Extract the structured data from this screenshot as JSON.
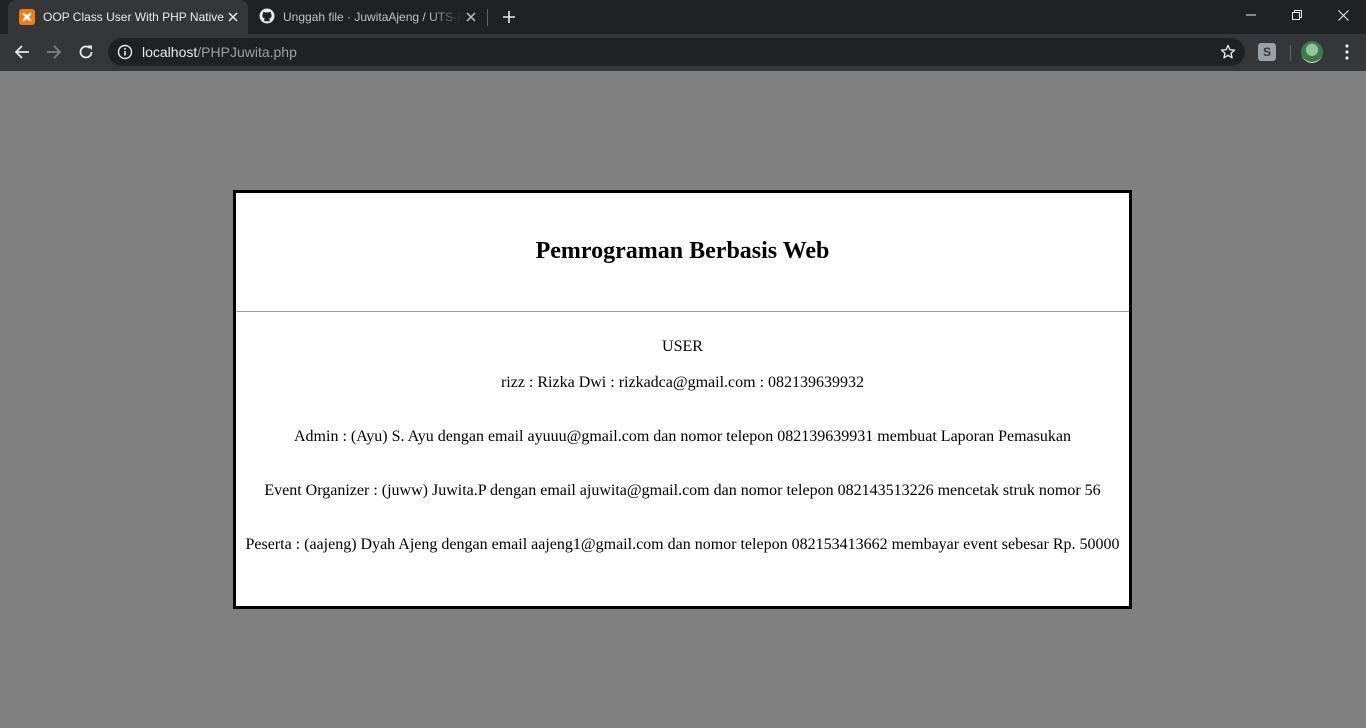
{
  "browser": {
    "tabs": [
      {
        "title": "OOP Class User With PHP Native",
        "icon": "xampp-icon",
        "active": true
      },
      {
        "title": "Unggah file · JuwitaAjeng / UTS-PBW",
        "icon": "github-icon",
        "active": false
      }
    ],
    "url_host": "localhost",
    "url_path": "/PHPJuwita.php",
    "extension_label": "S"
  },
  "page": {
    "heading": "Pemrograman Berbasis Web",
    "section_label": "USER",
    "user_line": "rizz : Rizka Dwi : rizkadca@gmail.com : 082139639932",
    "roles": [
      "Admin : (Ayu) S. Ayu dengan email ayuuu@gmail.com dan nomor telepon 082139639931 membuat Laporan Pemasukan",
      "Event Organizer : (juww) Juwita.P dengan email ajuwita@gmail.com dan nomor telepon 082143513226 mencetak struk nomor 56",
      "Peserta : (aajeng) Dyah Ajeng dengan email aajeng1@gmail.com dan nomor telepon 082153413662 membayar event sebesar Rp. 50000"
    ]
  },
  "colors": {
    "page_background": "#808080",
    "card_background": "#ffffff",
    "chrome_dark": "#202124",
    "chrome_toolbar": "#35363a",
    "xampp_orange": "#f07d1a"
  }
}
